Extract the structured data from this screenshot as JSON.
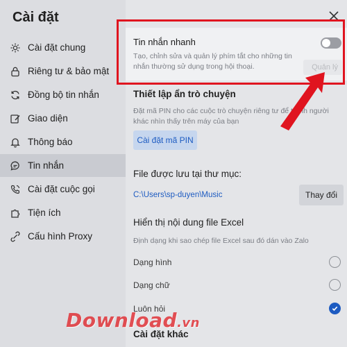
{
  "sidebar": {
    "title": "Cài đặt",
    "items": [
      {
        "label": "Cài đặt chung",
        "icon": "gear-icon"
      },
      {
        "label": "Riêng tư & bảo mật",
        "icon": "lock-icon"
      },
      {
        "label": "Đồng bộ tin nhắn",
        "icon": "sync-icon"
      },
      {
        "label": "Giao diện",
        "icon": "edit-icon"
      },
      {
        "label": "Thông báo",
        "icon": "bell-icon"
      },
      {
        "label": "Tin nhắn",
        "icon": "chat-icon",
        "active": true
      },
      {
        "label": "Cài đặt cuộc gọi",
        "icon": "phone-icon"
      },
      {
        "label": "Tiện ích",
        "icon": "puzzle-icon"
      },
      {
        "label": "Cấu hình Proxy",
        "icon": "proxy-icon"
      }
    ]
  },
  "main": {
    "quick_message": {
      "title": "Tin nhắn nhanh",
      "description": "Tạo, chỉnh sửa và quản lý phím tắt cho những tin nhắn thường sử dụng trong hội thoại.",
      "enabled": false,
      "faded_button": "Quản lý"
    },
    "hidden_chat": {
      "title": "Thiết lập ẩn trò chuyện",
      "description": "Đặt mã PIN cho các cuộc trò chuyện riêng tư để tránh người khác nhìn thấy trên máy của bạn",
      "button": "Cài đặt mã PIN"
    },
    "save_folder": {
      "title": "File được lưu tại thư mục:",
      "path": "C:\\Users\\sp-duyen\\Music",
      "button": "Thay đổi"
    },
    "excel": {
      "title": "Hiển thị nội dung file Excel",
      "description": "Định dạng khi sao chép file Excel sau đó dán vào Zalo",
      "options": [
        {
          "label": "Dạng hình",
          "selected": false
        },
        {
          "label": "Dạng chữ",
          "selected": false
        },
        {
          "label": "Luôn hỏi",
          "selected": true
        }
      ]
    },
    "other": {
      "title": "Cài đặt khác"
    }
  },
  "watermark": {
    "main": "Download",
    "tail": ".vn"
  },
  "colors": {
    "accent": "#1d5bc1",
    "highlight": "#e0141f"
  }
}
